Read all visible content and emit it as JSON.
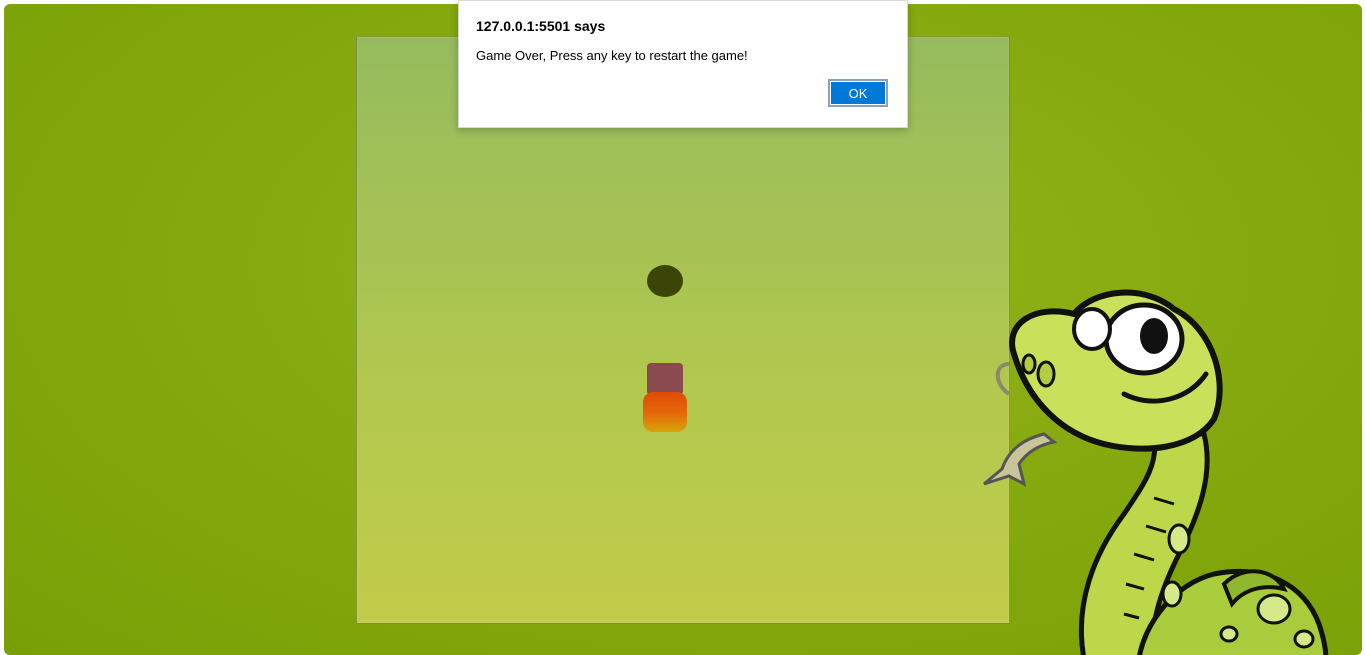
{
  "dialog": {
    "title": "127.0.0.1:5501 says",
    "message": "Game Over, Press any key to restart the game!",
    "ok_label": "OK"
  },
  "game": {
    "pieces": [
      {
        "name": "food",
        "color": "#3c4408"
      },
      {
        "name": "snake-body-segment",
        "color": "#8b4a4f"
      },
      {
        "name": "snake-head",
        "color": "#e5650a"
      }
    ]
  },
  "colors": {
    "background": "#86aa0f",
    "board": "#b0c74f",
    "dialog_button": "#0078d7"
  },
  "icons": {
    "mascot": "cartoon-snake-illustration"
  }
}
